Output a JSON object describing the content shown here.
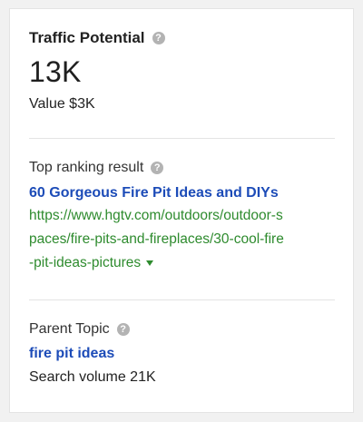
{
  "traffic": {
    "title": "Traffic Potential",
    "value": "13K",
    "value_line": "Value $3K"
  },
  "top_result": {
    "label": "Top ranking result",
    "link_title": "60 Gorgeous Fire Pit Ideas and DIYs",
    "url_lines": [
      "https://www.hgtv.com/outdoors/outdoor-s",
      "paces/fire-pits-and-fireplaces/30-cool-fire",
      "-pit-ideas-pictures"
    ]
  },
  "parent_topic": {
    "label": "Parent Topic",
    "topic": "fire pit ideas",
    "search_volume": "Search volume 21K"
  },
  "icons": {
    "help": "?"
  },
  "colors": {
    "link_blue": "#1d4cb8",
    "url_green": "#2e8b2e",
    "help_gray": "#b3b3b3"
  }
}
